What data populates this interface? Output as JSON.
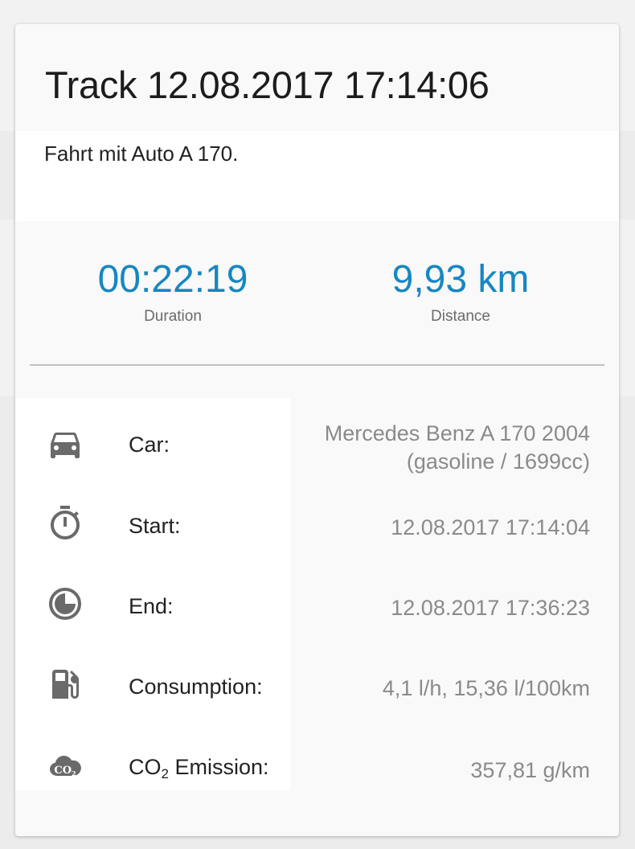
{
  "track": {
    "title": "Track 12.08.2017 17:14:06",
    "description": "Fahrt mit Auto A 170."
  },
  "stats": {
    "duration": {
      "value": "00:22:19",
      "label": "Duration"
    },
    "distance": {
      "value": "9,93 km",
      "label": "Distance"
    }
  },
  "details": {
    "car": {
      "icon": "car-icon",
      "label": "Car:",
      "value_line1": "Mercedes Benz A 170 2004",
      "value_line2": "(gasoline / 1699cc)"
    },
    "start": {
      "icon": "stopwatch-icon",
      "label": "Start:",
      "value": "12.08.2017 17:14:04"
    },
    "end": {
      "icon": "clock-icon",
      "label": "End:",
      "value": "12.08.2017 17:36:23"
    },
    "consumption": {
      "icon": "fuel-pump-icon",
      "label": "Consumption:",
      "value": "4,1 l/h, 15,36 l/100km"
    },
    "co2": {
      "icon": "co2-cloud-icon",
      "label_prefix": "CO",
      "label_sub": "2",
      "label_suffix": " Emission:",
      "value": "357,81 g/km"
    }
  },
  "colors": {
    "accent": "#1787c1",
    "icon": "#6a6a6a",
    "value_text": "#8a8a8a"
  }
}
